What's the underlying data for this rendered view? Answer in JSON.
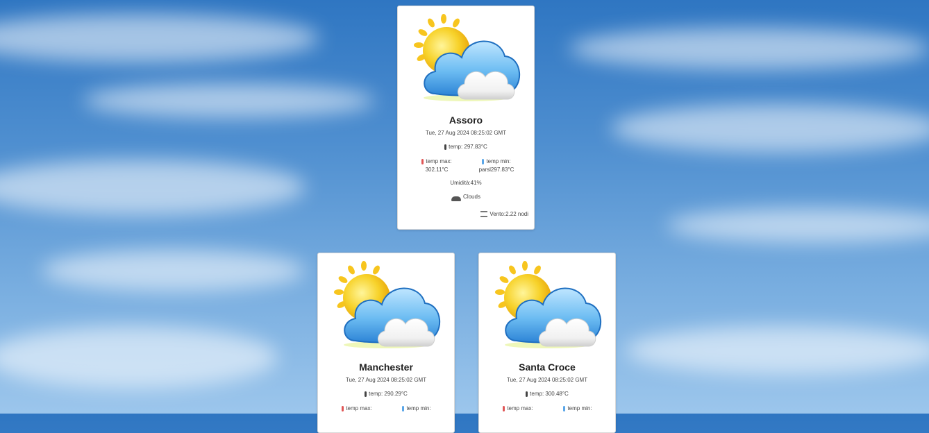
{
  "cards": [
    {
      "city": "Assoro",
      "date": "Tue, 27 Aug 2024 08:25:02 GMT",
      "temp": "temp: 297.83°C",
      "temp_max_label": "temp max:",
      "temp_max_value": "302.11°C",
      "temp_min_label": "temp min:",
      "temp_min_value": "parsl297.83°C",
      "humidity": "Umidità:41%",
      "sky": "Clouds",
      "wind": "Vento:2.22 nodi"
    },
    {
      "city": "Manchester",
      "date": "Tue, 27 Aug 2024 08:25:02 GMT",
      "temp": "temp: 290.29°C",
      "temp_max_label": "temp max:",
      "temp_min_label": "temp min:"
    },
    {
      "city": "Santa Croce",
      "date": "Tue, 27 Aug 2024 08:25:02 GMT",
      "temp": "temp: 300.48°C",
      "temp_max_label": "temp max:",
      "temp_min_label": "temp min:"
    }
  ],
  "icons": {
    "weather_art": "sun-behind-cloud-icon",
    "thermometer": "thermometer-icon",
    "clouds": "clouds-icon",
    "wind": "wind-icon"
  },
  "colors": {
    "sky_top": "#2f76c2",
    "sky_bottom": "#9cc6ec",
    "card_bg": "#ffffff",
    "sun": "#f7c51e",
    "cloud_blue": "#5fb0ea",
    "max_red": "#e05656",
    "min_blue": "#5aa6e8"
  }
}
